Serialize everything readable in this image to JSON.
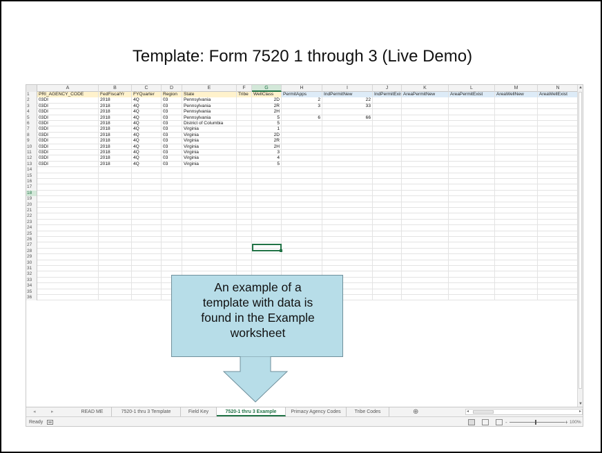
{
  "slide": {
    "title": "Template: Form 7520 1 through 3 (Live Demo)"
  },
  "spreadsheet": {
    "columns": [
      "A",
      "B",
      "C",
      "D",
      "E",
      "F",
      "G",
      "H",
      "I",
      "J",
      "K",
      "L",
      "M",
      "N"
    ],
    "selected_column": "G",
    "header_row": [
      "PRI_AGENCY_CODE",
      "FedFiscalYr",
      "FYQuarter",
      "Region",
      "State",
      "Tribe",
      "WellClass",
      "PermitApps",
      "IndPermitNew",
      "IndPermitExist",
      "AreaPermitNew",
      "AreaPermitExist",
      "AreaWellNew",
      "AreaWellExist"
    ],
    "data_rows": [
      [
        "03DI",
        "2018",
        "4Q",
        "03",
        "Pennsylvania",
        "",
        "2D",
        "2",
        "22",
        "",
        "",
        "",
        "",
        ""
      ],
      [
        "03DI",
        "2018",
        "4Q",
        "03",
        "Pennsylvania",
        "",
        "2R",
        "3",
        "33",
        "",
        "",
        "",
        "",
        ""
      ],
      [
        "03DI",
        "2018",
        "4Q",
        "03",
        "Pennsylvania",
        "",
        "2H",
        "",
        "",
        "",
        "",
        "",
        "",
        ""
      ],
      [
        "03DI",
        "2018",
        "4Q",
        "03",
        "Pennsylvania",
        "",
        "5",
        "6",
        "66",
        "",
        "",
        "",
        "",
        ""
      ],
      [
        "03DI",
        "2018",
        "4Q",
        "03",
        "District of Columbia",
        "",
        "5",
        "",
        "",
        "",
        "",
        "",
        "",
        ""
      ],
      [
        "03DI",
        "2018",
        "4Q",
        "03",
        "Virginia",
        "",
        "1",
        "",
        "",
        "",
        "",
        "",
        "",
        ""
      ],
      [
        "03DI",
        "2018",
        "4Q",
        "03",
        "Virginia",
        "",
        "2D",
        "",
        "",
        "",
        "",
        "",
        "",
        ""
      ],
      [
        "03DI",
        "2018",
        "4Q",
        "03",
        "Virginia",
        "",
        "2R",
        "",
        "",
        "",
        "",
        "",
        "",
        ""
      ],
      [
        "03DI",
        "2018",
        "4Q",
        "03",
        "Virginia",
        "",
        "2H",
        "",
        "",
        "",
        "",
        "",
        "",
        ""
      ],
      [
        "03DI",
        "2018",
        "4Q",
        "03",
        "Virginia",
        "",
        "3",
        "",
        "",
        "",
        "",
        "",
        "",
        ""
      ],
      [
        "03DI",
        "2018",
        "4Q",
        "03",
        "Virginia",
        "",
        "4",
        "",
        "",
        "",
        "",
        "",
        "",
        ""
      ],
      [
        "03DI",
        "2018",
        "4Q",
        "03",
        "Virginia",
        "",
        "5",
        "",
        "",
        "",
        "",
        "",
        "",
        ""
      ]
    ],
    "row_numbers": [
      "1",
      "2",
      "3",
      "4",
      "5",
      "6",
      "7",
      "8",
      "9",
      "10",
      "11",
      "12",
      "13",
      "14",
      "15",
      "16",
      "17",
      "18",
      "19",
      "20",
      "21",
      "22",
      "23",
      "24",
      "25",
      "26",
      "27",
      "28",
      "29",
      "30",
      "31",
      "32",
      "33",
      "34",
      "35",
      "36"
    ],
    "selected_row": "18",
    "selected_cell": "G18"
  },
  "tabs": {
    "prev_label": "◂",
    "next_label": "▸",
    "items": [
      "READ ME",
      "7520-1 thru 3 Template",
      "Field Key",
      "7520-1 thru 3 Example",
      "Primacy Agency Codes",
      "Tribe Codes"
    ],
    "active": "7520-1 thru 3 Example",
    "add_label": "⊕"
  },
  "status": {
    "text": "Ready",
    "zoom": "100%",
    "zoom_minus": "-",
    "zoom_plus": "+"
  },
  "callout": {
    "text": "An example of a template with data is found in the Example worksheet",
    "lines": [
      "An example of a",
      "template with data is",
      "found in the Example",
      "worksheet"
    ],
    "fill": "#b7dde8"
  },
  "colors": {
    "excel_green": "#217346",
    "header_fill": "#fff2cc",
    "header_fill_blue": "#ddebf7"
  }
}
